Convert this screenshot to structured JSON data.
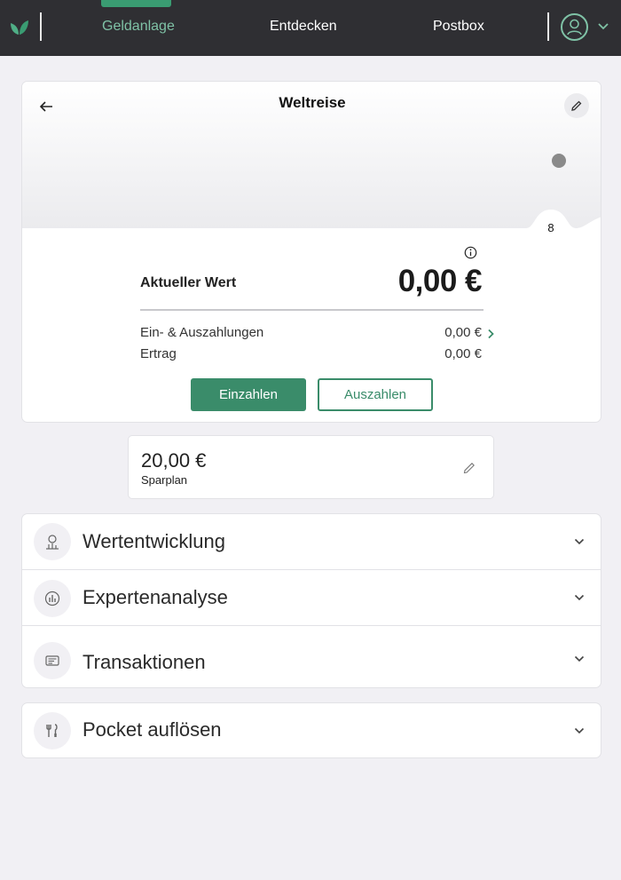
{
  "nav": {
    "items": [
      {
        "label": "Geldanlage",
        "active": true
      },
      {
        "label": "Entdecken",
        "active": false
      },
      {
        "label": "Postbox",
        "active": false
      }
    ]
  },
  "colors": {
    "brand_green": "#3a8c6a",
    "nav_bg": "#2f2f33",
    "nav_active_text": "#7fc2a6",
    "page_bg": "#f1f0f4"
  },
  "card": {
    "title": "Weltreise",
    "slider_number": "8",
    "current_value_label": "Aktueller Wert",
    "current_value": "0,00 €",
    "rows": [
      {
        "label": "Ein- & Auszahlungen",
        "value": "0,00 €"
      },
      {
        "label": "Ertrag",
        "value": "0,00 €"
      }
    ],
    "deposit_label": "Einzahlen",
    "withdraw_label": "Auszahlen"
  },
  "sparplan": {
    "amount": "20,00 €",
    "label": "Sparplan"
  },
  "sections": [
    {
      "label": "Wertentwicklung",
      "icon": "chart-growth-icon"
    },
    {
      "label": "Expertenanalyse",
      "icon": "analysis-icon"
    },
    {
      "label": "Transaktionen",
      "icon": "transactions-icon"
    }
  ],
  "dissolve": {
    "label": "Pocket auflösen",
    "icon": "tools-icon"
  }
}
